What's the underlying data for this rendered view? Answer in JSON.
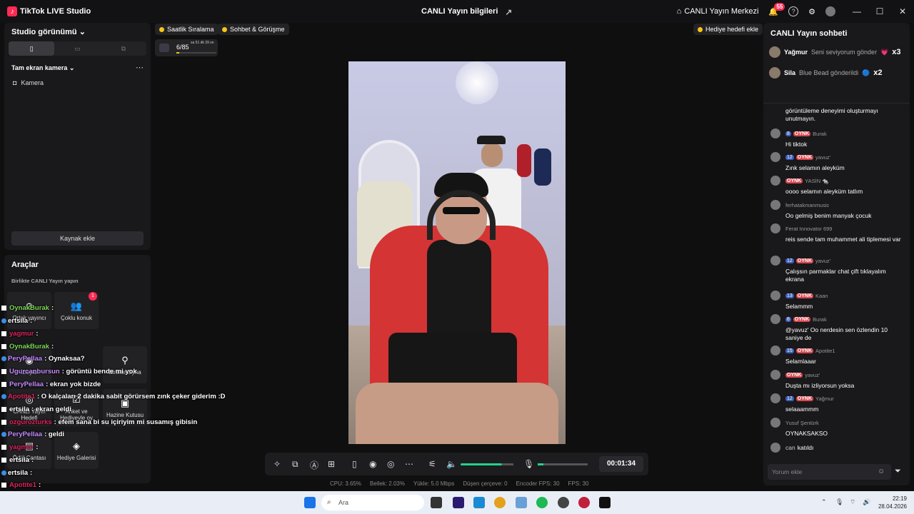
{
  "app": {
    "title": "TikTok LIVE Studio",
    "center_title": "CANLI Yayın bilgileri",
    "live_center": "CANLI Yayın Merkezi",
    "notif_count": "55"
  },
  "studio": {
    "view_label": "Studio görünümü",
    "source_group": "Tam ekran kamera",
    "camera": "Kamera",
    "add_source": "Kaynak ekle"
  },
  "tools": {
    "title": "Araçlar",
    "collab": "Birlikte CANLI Yayın yapın",
    "badge": "1",
    "tiles": [
      "Ortak yayıncı",
      "Çoklu konuk",
      "İzleyici",
      "Birlikte Oyna",
      "CANLI Yayın Hedefi",
      "Anket ve Hediyeyle oy",
      "Hazine Kutusu",
      "Ödül Çantası",
      "Hediye Galerisi"
    ]
  },
  "overlay_chat": [
    {
      "user": "OynakBurak",
      "text": ":",
      "color": "#7ed957"
    },
    {
      "user": "ertsila",
      "text": ":",
      "color": "#ffffff"
    },
    {
      "user": "yagmur",
      "text": ":",
      "color": "#e0245e"
    },
    {
      "user": "OynakBurak",
      "text": ":",
      "color": "#7ed957"
    },
    {
      "user": "PeryPellaa",
      "text": ": Oynaksaa?",
      "color": "#c58cff"
    },
    {
      "user": "Ugurcanbursun",
      "text": ": görüntü bende mi yok",
      "color": "#c58cff"
    },
    {
      "user": "PeryPellaa",
      "text": ": ekran yok bizde",
      "color": "#c58cff"
    },
    {
      "user": "Apotite1",
      "text": ": O kalçaları 2 dakika sabit görürsem zınk çeker giderim :D",
      "color": "#e0245e"
    },
    {
      "user": "ertsila",
      "text": ": ekran geldi",
      "color": "#ffffff"
    },
    {
      "user": "ozgurozturks",
      "text": ": efem sana bi su içiriyim mi susamış gibisin",
      "color": "#e0245e"
    },
    {
      "user": "PeryPellaa",
      "text": ": geldi",
      "color": "#c58cff"
    },
    {
      "user": "yagmur",
      "text": ":",
      "color": "#e0245e"
    },
    {
      "user": "ertsila",
      "text": ":",
      "color": "#ffffff"
    },
    {
      "user": "ertsila",
      "text": ":",
      "color": "#ffffff"
    },
    {
      "user": "Apotite1",
      "text": ":",
      "color": "#e0245e"
    }
  ],
  "pills": {
    "hourly": "Saatlik Sıralama",
    "chat_meet": "Sohbet & Görüşme",
    "gift_goal": "Hediye hedefi ekle"
  },
  "goal": {
    "progress": "6/85",
    "time": "sa 51 dk 39 sn",
    "fill_fraction": 0.07
  },
  "controls": {
    "timer": "00:01:34"
  },
  "stats": {
    "cpu": "CPU: 3.65%",
    "mem": "Bellek: 2.03%",
    "upload": "Yükle: 5.0 Mbps",
    "dropped": "Düşen çerçeve: 0",
    "encoder": "Encoder FPS: 30",
    "fps": "FPS: 30"
  },
  "chat": {
    "title": "CANLI Yayın sohbeti",
    "pinned": [
      {
        "user": "Yağmur",
        "action": "Seni seviyorum gönder",
        "count": "x3"
      },
      {
        "user": "Sila",
        "action": "Blue Bead gönderildi",
        "count": "x2"
      }
    ],
    "intro": "görüntüleme deneyimi oluşturmayı unutmayın.",
    "messages": [
      {
        "lvl": "8",
        "tag": "OYNK",
        "user": "Burak",
        "text": "Hi tiktok"
      },
      {
        "lvl": "12",
        "tag": "OYNK",
        "user": "yavuz'",
        "text": "Zınk selamın aleyküm"
      },
      {
        "lvl": "",
        "tag": "OYNK",
        "user": "YASİN 🐀",
        "text": "oooo selamın aleyküm tatlım"
      },
      {
        "lvl": "",
        "tag": "",
        "user": "ferhatakmanmusic",
        "text": "Oo gelmiş benim manyak çocuk"
      },
      {
        "lvl": "",
        "tag": "",
        "user": "Ferat Innovator 699",
        "text": "reis sende tam muhammet ali tiplemesi var"
      },
      {
        "lvl": "12",
        "tag": "OYNK",
        "user": "yavuz'",
        "text": "Çalışsın parmaklar chat çift tıklayalım ekrana"
      },
      {
        "lvl": "13",
        "tag": "OYNK",
        "user": "Kaan",
        "text": "Selammm"
      },
      {
        "lvl": "8",
        "tag": "OYNK",
        "user": "Burak",
        "text": "@yavuz' Oo nerdesin sen özlendin 10 saniye de"
      },
      {
        "lvl": "15",
        "tag": "OYNK",
        "user": "Apotite1",
        "text": "Selamlaaar"
      },
      {
        "lvl": "",
        "tag": "OYNK",
        "user": "yavuz'",
        "text": "Duşta mı izliyorsun yoksa"
      },
      {
        "lvl": "12",
        "tag": "OYNK",
        "user": "Yağmur",
        "text": "selaaammm"
      },
      {
        "lvl": "",
        "tag": "",
        "user": "Yusuf Şentürk",
        "text": "OYNAKSAKSO"
      }
    ],
    "joined_user": "can",
    "joined_text": "katıldı",
    "comment_placeholder": "Yorum ekle"
  },
  "taskbar": {
    "search": "Ara",
    "time": "22:19",
    "date": "28.04.2026"
  }
}
